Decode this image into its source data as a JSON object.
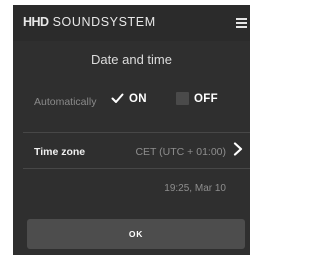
{
  "header": {
    "brand_mark": "HHD",
    "brand_name": "SOUNDSYSTEM",
    "menu_icon": "hamburger-menu-icon"
  },
  "page": {
    "title": "Date and time"
  },
  "automatic": {
    "label": "Automatically",
    "on_label": "ON",
    "off_label": "OFF",
    "selected": "ON"
  },
  "timezone": {
    "label": "Time zone",
    "value": "CET (UTC + 01:00)",
    "icon": "chevron-right-icon"
  },
  "current_datetime": "19:25, Mar 10",
  "actions": {
    "ok_label": "OK"
  },
  "colors": {
    "background": "#2f2f2f",
    "topbar": "#2b2b2b",
    "button": "#4d4d4d",
    "muted_text": "#8a8a8a",
    "text": "#ffffff"
  }
}
